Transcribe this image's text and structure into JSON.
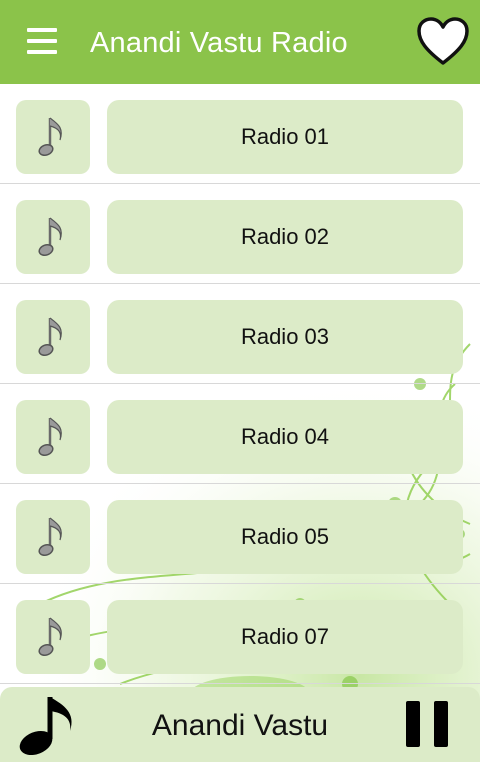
{
  "header": {
    "title": "Anandi Vastu Radio",
    "menu_icon": "hamburger-menu-icon",
    "favorite_icon": "heart-outline-icon",
    "color": "#8bc34a"
  },
  "stations": [
    {
      "label": "Radio 01",
      "icon": "music-note-icon"
    },
    {
      "label": "Radio 02",
      "icon": "music-note-icon"
    },
    {
      "label": "Radio 03",
      "icon": "music-note-icon"
    },
    {
      "label": "Radio 04",
      "icon": "music-note-icon"
    },
    {
      "label": "Radio 05",
      "icon": "music-note-icon"
    },
    {
      "label": "Radio 07",
      "icon": "music-note-icon"
    }
  ],
  "player": {
    "now_playing": "Anandi Vastu",
    "state": "playing",
    "control_icon": "pause-icon"
  },
  "colors": {
    "button_bg": "#dcebc8",
    "text": "#111111"
  }
}
